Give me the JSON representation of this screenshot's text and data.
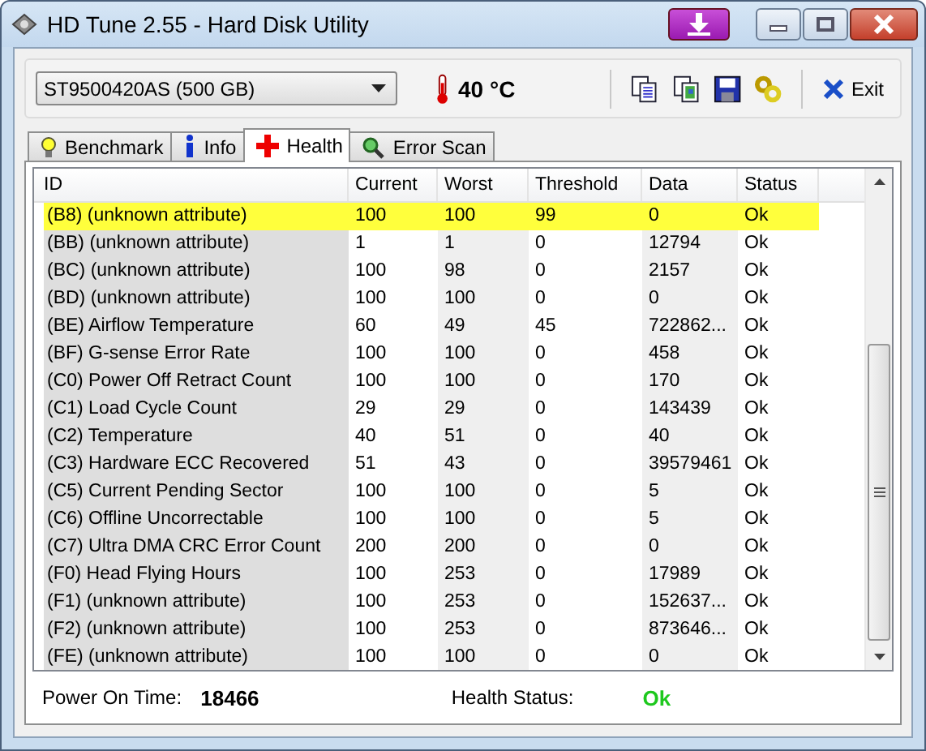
{
  "window": {
    "title": "HD Tune 2.55 - Hard Disk Utility"
  },
  "toolbar": {
    "drive": "ST9500420AS (500 GB)",
    "temperature": "40 °C",
    "exit_label": "Exit"
  },
  "tabs": [
    {
      "label": "Benchmark",
      "selected": false
    },
    {
      "label": "Info",
      "selected": false
    },
    {
      "label": "Health",
      "selected": true
    },
    {
      "label": "Error Scan",
      "selected": false
    }
  ],
  "table": {
    "columns": [
      "ID",
      "Current",
      "Worst",
      "Threshold",
      "Data",
      "Status"
    ],
    "rows": [
      {
        "cells": [
          "(B8) (unknown attribute)",
          "100",
          "100",
          "99",
          "0",
          "Ok"
        ],
        "selected": true
      },
      {
        "cells": [
          "(BB) (unknown attribute)",
          "1",
          "1",
          "0",
          "12794",
          "Ok"
        ],
        "selected": false
      },
      {
        "cells": [
          "(BC) (unknown attribute)",
          "100",
          "98",
          "0",
          "2157",
          "Ok"
        ],
        "selected": false
      },
      {
        "cells": [
          "(BD) (unknown attribute)",
          "100",
          "100",
          "0",
          "0",
          "Ok"
        ],
        "selected": false
      },
      {
        "cells": [
          "(BE) Airflow Temperature",
          "60",
          "49",
          "45",
          "722862...",
          "Ok"
        ],
        "selected": false
      },
      {
        "cells": [
          "(BF) G-sense Error Rate",
          "100",
          "100",
          "0",
          "458",
          "Ok"
        ],
        "selected": false
      },
      {
        "cells": [
          "(C0) Power Off Retract Count",
          "100",
          "100",
          "0",
          "170",
          "Ok"
        ],
        "selected": false
      },
      {
        "cells": [
          "(C1) Load Cycle Count",
          "29",
          "29",
          "0",
          "143439",
          "Ok"
        ],
        "selected": false
      },
      {
        "cells": [
          "(C2) Temperature",
          "40",
          "51",
          "0",
          "40",
          "Ok"
        ],
        "selected": false
      },
      {
        "cells": [
          "(C3) Hardware ECC Recovered",
          "51",
          "43",
          "0",
          "39579461",
          "Ok"
        ],
        "selected": false
      },
      {
        "cells": [
          "(C5) Current Pending Sector",
          "100",
          "100",
          "0",
          "5",
          "Ok"
        ],
        "selected": false
      },
      {
        "cells": [
          "(C6) Offline Uncorrectable",
          "100",
          "100",
          "0",
          "5",
          "Ok"
        ],
        "selected": false
      },
      {
        "cells": [
          "(C7) Ultra DMA CRC Error Count",
          "200",
          "200",
          "0",
          "0",
          "Ok"
        ],
        "selected": false
      },
      {
        "cells": [
          "(F0) Head Flying Hours",
          "100",
          "253",
          "0",
          "17989",
          "Ok"
        ],
        "selected": false
      },
      {
        "cells": [
          "(F1) (unknown attribute)",
          "100",
          "253",
          "0",
          "152637...",
          "Ok"
        ],
        "selected": false
      },
      {
        "cells": [
          "(F2) (unknown attribute)",
          "100",
          "253",
          "0",
          "873646...",
          "Ok"
        ],
        "selected": false
      },
      {
        "cells": [
          "(FE) (unknown attribute)",
          "100",
          "100",
          "0",
          "0",
          "Ok"
        ],
        "selected": false
      }
    ]
  },
  "footer": {
    "power_on_label": "Power On Time:",
    "power_on_value": "18466",
    "health_label": "Health Status:",
    "health_value": "Ok"
  }
}
